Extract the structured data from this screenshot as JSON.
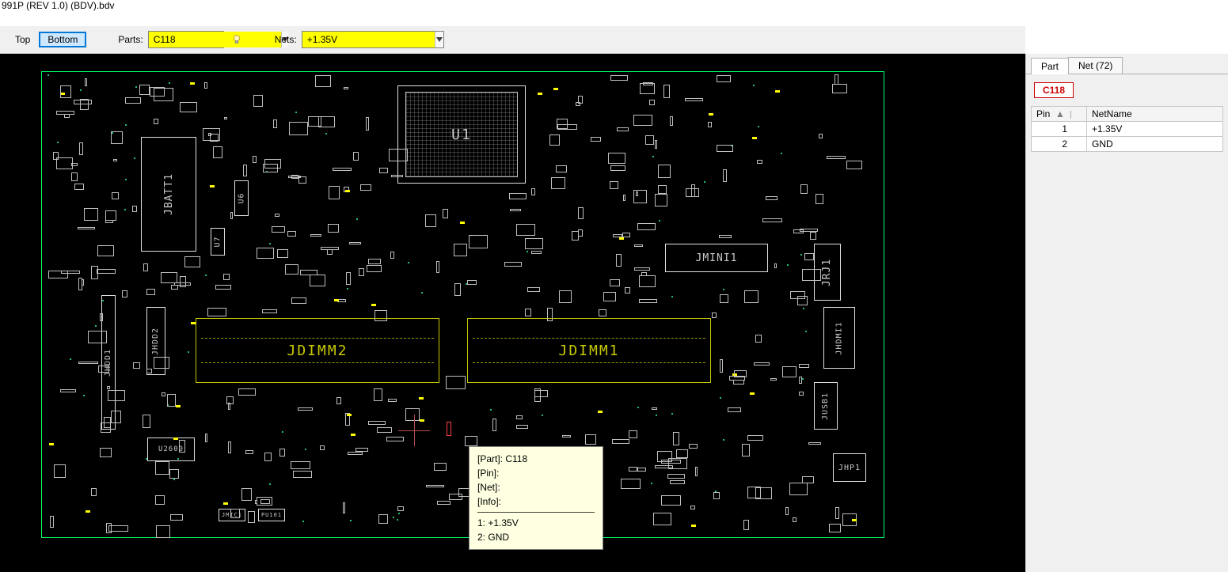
{
  "title": "991P (REV 1.0) (BDV).bdv",
  "toolbar": {
    "top_label": "Top",
    "bottom_label": "Bottom",
    "active_layer": "Bottom",
    "parts_label": "Parts:",
    "parts_value": "C118",
    "nets_label": "Nets:",
    "nets_value": "+1.35V"
  },
  "side": {
    "tabs": [
      {
        "id": "part",
        "label": "Part",
        "active": true
      },
      {
        "id": "net",
        "label": "Net (72)",
        "active": false
      }
    ],
    "part_chip": "C118",
    "table": {
      "columns": {
        "pin": "Pin",
        "net": "NetName"
      },
      "rows": [
        {
          "pin": "1",
          "net": "+1.35V"
        },
        {
          "pin": "2",
          "net": "GND"
        }
      ]
    }
  },
  "tooltip": {
    "part_label": "[Part]:",
    "part_value": "C118",
    "pin_label": "[Pin]:",
    "pin_value": "",
    "net_label": "[Net]:",
    "net_value": "",
    "info_label": "[Info]:",
    "info_value": "",
    "pins": [
      {
        "label": "1:",
        "value": "+1.35V"
      },
      {
        "label": "2:",
        "value": "GND"
      }
    ]
  },
  "refs": {
    "u1": "U1",
    "jbatt1": "JBATT1",
    "u6": "U6",
    "u7": "U7",
    "jhdd1": "JHDD1",
    "jhdd2": "JHDD2",
    "jdimm2": "JDIMM2",
    "jdimm1": "JDIMM1",
    "jmini1": "JMINI1",
    "jrj1": "JRJ1",
    "jhdmi1": "JHDMI1",
    "jusb1": "JUSB1",
    "jhp1": "JHP1",
    "u2600": "U2600",
    "jmic1": "JMIC1",
    "pu101": "PU101"
  }
}
